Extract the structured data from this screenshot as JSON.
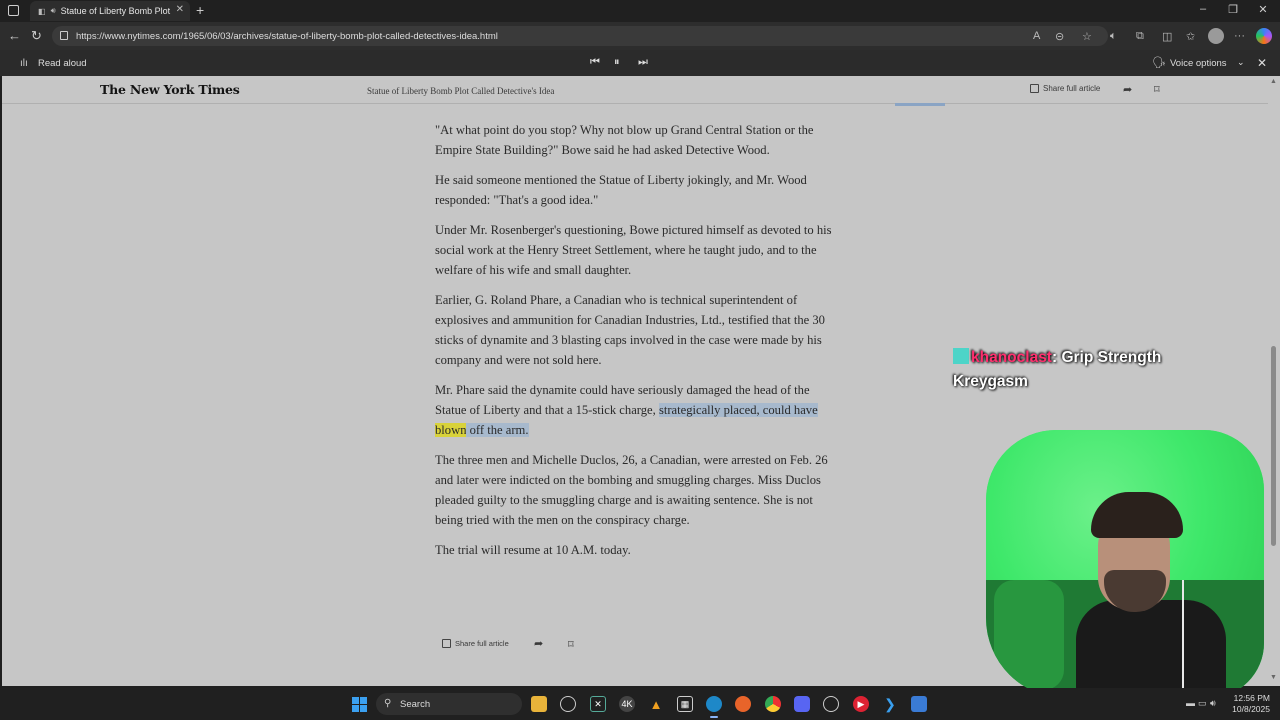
{
  "browser": {
    "tab_title": "Statue of Liberty Bomb Plot",
    "url": "https://www.nytimes.com/1965/06/03/archives/statue-of-liberty-bomb-plot-called-detectives-idea.html"
  },
  "read_aloud": {
    "label": "Read aloud",
    "voice_options": "Voice options"
  },
  "nyt": {
    "logo": "The New York Times",
    "header_title": "Statue of Liberty Bomb Plot Called Detective's Idea",
    "share_label": "Share full article"
  },
  "article": {
    "paragraphs": [
      "\"At what point do you stop? Why not blow up Grand Central Station or the Empire State Building?\" Bowe said he had asked Detective Wood.",
      "He said someone mentioned the Statue of Liberty jokingly, and Mr. Wood responded: \"That's a good idea.\"",
      "Under Mr. Rosenberger's questioning, Bowe pictured himself as devoted to his social work at the Henry Street Settlement, where he taught judo, and to the welfare of his wife and small daughter.",
      "Earlier, G. Roland Phare, a Canadian who is technical superintendent of explosives and ammunition for Canadian Industries, Ltd., testified that the 30 sticks of dynamite and 3 blasting caps involved in the case were made by his company and were not sold here.",
      "The three men and Michelle Duclos, 26, a Canadian, were arrested on Feb. 26 and later were indicted on the bombing and smuggling charges. Miss Duclos pleaded guilty to the smuggling charge and is awaiting sentence. She is not being tried with the men on the conspiracy charge.",
      "The trial will resume at 10 A.M. today."
    ],
    "highlight_para": {
      "before": "Mr. Phare said the dynamite could have seriously damaged the head of the Statue of Liberty and that a 15-stick charge, ",
      "hl_before": "strategically placed, could have ",
      "hl_word": "blown",
      "hl_after": " off the arm."
    }
  },
  "chat": {
    "user": "khanoclast",
    "message": ": Grip Strength Kreygasm"
  },
  "taskbar": {
    "search_placeholder": "Search",
    "time": "12:56 PM",
    "date": "10/8/2025"
  },
  "colors": {
    "page_dim": "#c6c6c6",
    "highlight_sentence": "#a7b9cd",
    "highlight_word": "#d8d23a",
    "chat_user": "#ff2f6e",
    "webcam_bg": "#3ee86a"
  }
}
